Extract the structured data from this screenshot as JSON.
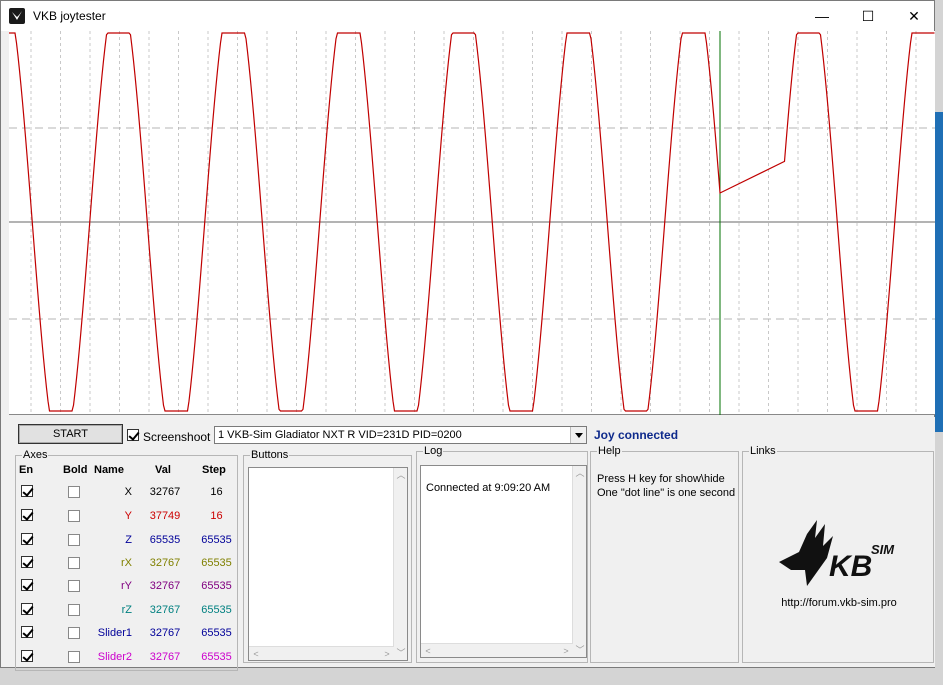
{
  "window": {
    "title": "VKB joytester",
    "controls": {
      "minimize": "—",
      "maximize": "☐",
      "close": "✕"
    }
  },
  "toolbar": {
    "start_label": "START",
    "screenshot_label": "Screenshoot",
    "screenshot_checked": true,
    "device": "1  VKB-Sim Gladiator NXT R   VID=231D PID=0200",
    "status": "Joy connected",
    "status_color": "#0e2a8c"
  },
  "axes": {
    "group_label": "Axes",
    "headers": {
      "en": "En",
      "bold": "Bold",
      "name": "Name",
      "val": "Val",
      "step": "Step"
    },
    "rows": [
      {
        "name": "X",
        "val": "32767",
        "step": "16",
        "en": true,
        "bold": false,
        "color": "#000000"
      },
      {
        "name": "Y",
        "val": "37749",
        "step": "16",
        "en": true,
        "bold": false,
        "color": "#cc0000"
      },
      {
        "name": "Z",
        "val": "65535",
        "step": "65535",
        "en": true,
        "bold": false,
        "color": "#000099"
      },
      {
        "name": "rX",
        "val": "32767",
        "step": "65535",
        "en": true,
        "bold": false,
        "color": "#808000"
      },
      {
        "name": "rY",
        "val": "32767",
        "step": "65535",
        "en": true,
        "bold": false,
        "color": "#800080"
      },
      {
        "name": "rZ",
        "val": "32767",
        "step": "65535",
        "en": true,
        "bold": false,
        "color": "#008080"
      },
      {
        "name": "Slider1",
        "val": "32767",
        "step": "65535",
        "en": true,
        "bold": false,
        "color": "#000099"
      },
      {
        "name": "Slider2",
        "val": "32767",
        "step": "65535",
        "en": true,
        "bold": false,
        "color": "#cc00cc"
      }
    ]
  },
  "buttons": {
    "group_label": "Buttons"
  },
  "log": {
    "group_label": "Log",
    "entries": [
      "Connected at 9:09:20 AM"
    ]
  },
  "help": {
    "group_label": "Help",
    "lines": [
      "Press H key for show\\hide",
      "One \"dot line\" is one second"
    ]
  },
  "links": {
    "group_label": "Links",
    "logo_text": "KB",
    "logo_sup": "SIM",
    "url": "http://forum.vkb-sim.pro"
  },
  "plot": {
    "trace_color": "#c00000",
    "cursor_color": "#007000"
  }
}
